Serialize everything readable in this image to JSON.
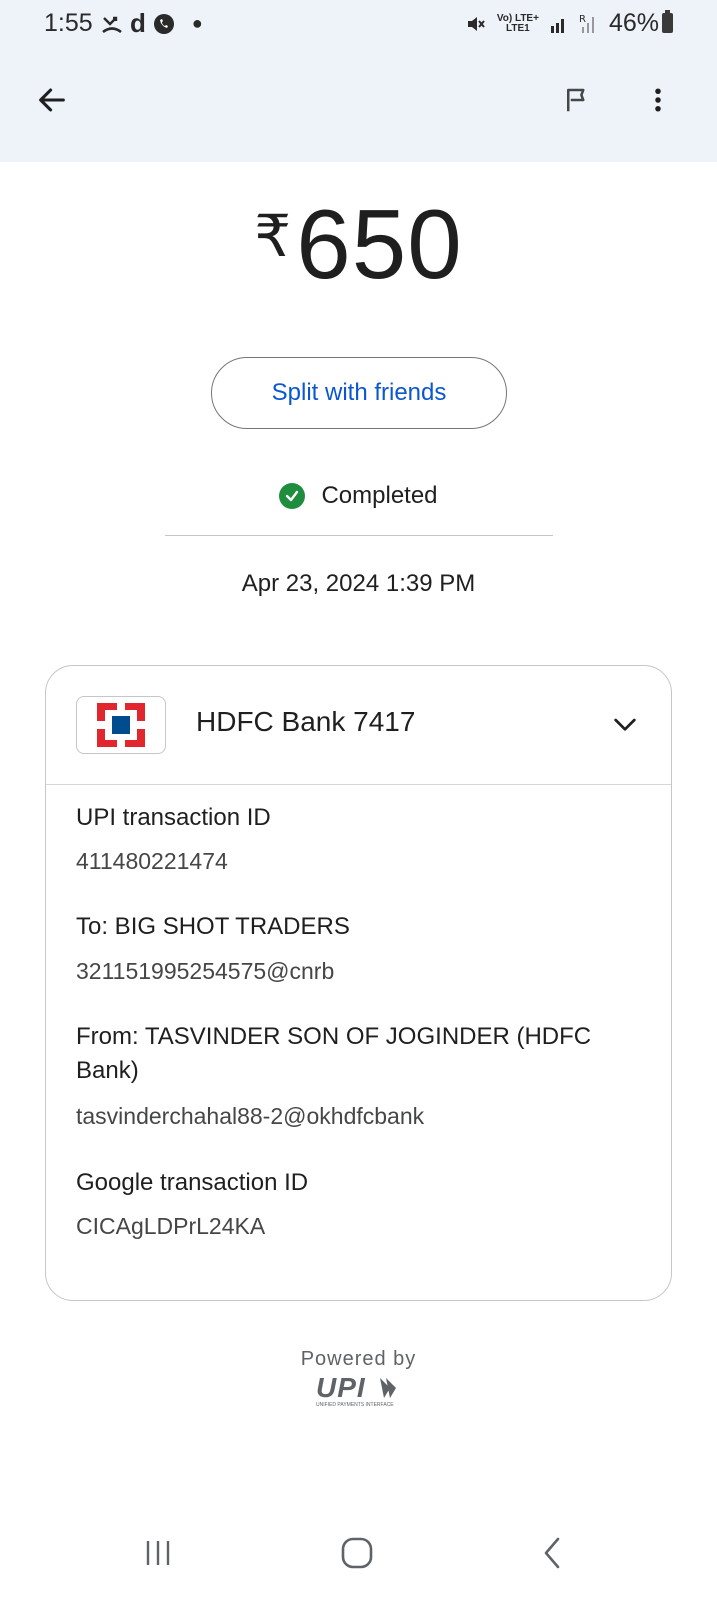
{
  "status_bar": {
    "time": "1:55",
    "left_icons": [
      "missed-call-icon",
      "d-app-icon",
      "whatsapp-icon",
      "dot-icon"
    ],
    "network_top": "Vo) LTE+",
    "network_bottom": "LTE1",
    "battery": "46%"
  },
  "app_bar": {
    "back_icon": "arrow-left-icon",
    "report_icon": "flag-icon",
    "more_icon": "more-vert-icon"
  },
  "payment": {
    "currency_symbol": "₹",
    "amount": "650",
    "split_label": "Split with friends",
    "status": "Completed",
    "datetime": "Apr 23, 2024 1:39 PM"
  },
  "details": {
    "bank_name": "HDFC Bank 7417",
    "upi_id_label": "UPI transaction ID",
    "upi_id_value": "411480221474",
    "to_label": "To: BIG SHOT TRADERS",
    "to_value": "321151995254575@cnrb",
    "from_label": "From: TASVINDER SON OF JOGINDER (HDFC Bank)",
    "from_value": "tasvinderchahal88-2@okhdfcbank",
    "google_id_label": "Google transaction ID",
    "google_id_value": "CICAgLDPrL24KA"
  },
  "footer": {
    "powered_by": "Powered by",
    "upi_text": "UPI",
    "upi_subtext": "UNIFIED PAYMENTS INTERFACE"
  },
  "colors": {
    "header_bg": "#eef2f9",
    "accent_blue": "#0b57d0",
    "success_green": "#1e8e3e",
    "hdfc_red": "#e1262d",
    "hdfc_blue": "#004c8f"
  }
}
